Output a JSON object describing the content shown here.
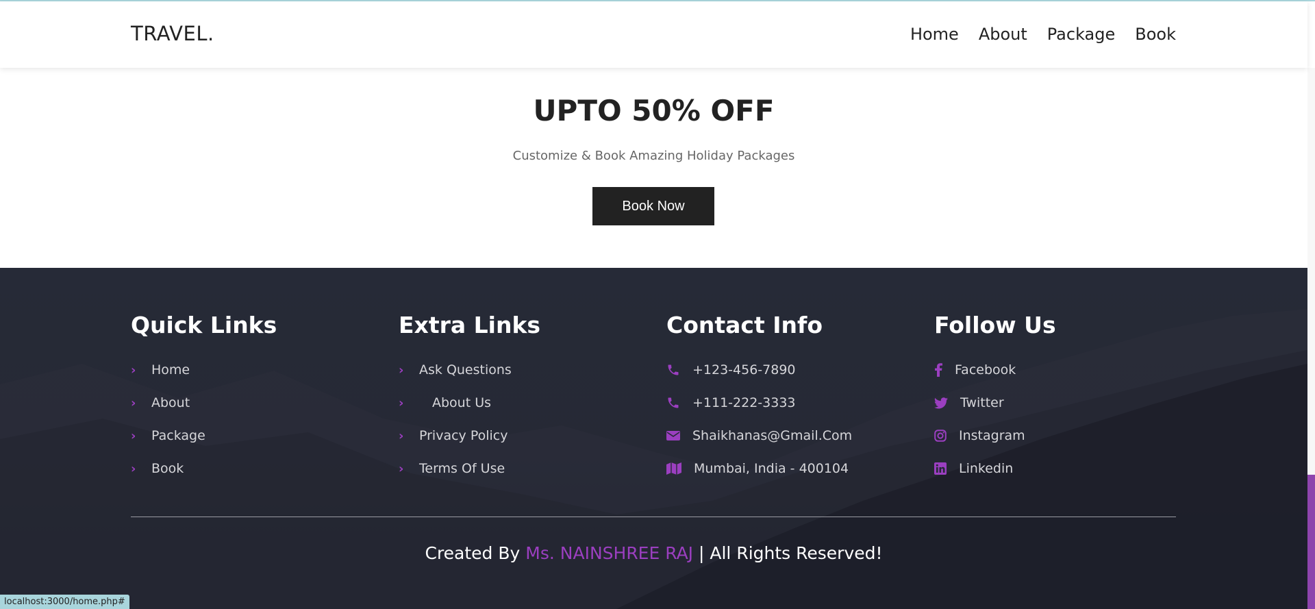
{
  "header": {
    "logo": "TRAVEL.",
    "nav": [
      "Home",
      "About",
      "Package",
      "Book"
    ]
  },
  "hero": {
    "title": "UPTO 50% OFF",
    "subtitle": "Customize & Book Amazing Holiday Packages",
    "button": "Book Now"
  },
  "footer": {
    "quick_links": {
      "title": "Quick Links",
      "items": [
        "Home",
        "About",
        "Package",
        "Book"
      ]
    },
    "extra_links": {
      "title": "Extra Links",
      "items": [
        "Ask Questions",
        "About Us",
        "Privacy Policy",
        "Terms Of Use"
      ]
    },
    "contact": {
      "title": "Contact Info",
      "items": [
        {
          "icon": "phone-icon",
          "text": "+123-456-7890"
        },
        {
          "icon": "phone-icon",
          "text": "+111-222-3333"
        },
        {
          "icon": "envelope-icon",
          "text": "Shaikhanas@Gmail.Com"
        },
        {
          "icon": "map-icon",
          "text": "Mumbai, India - 400104"
        }
      ]
    },
    "follow": {
      "title": "Follow Us",
      "items": [
        {
          "icon": "facebook-icon",
          "text": "Facebook"
        },
        {
          "icon": "twitter-icon",
          "text": "Twitter"
        },
        {
          "icon": "instagram-icon",
          "text": "Instagram"
        },
        {
          "icon": "linkedin-icon",
          "text": "Linkedin"
        }
      ]
    },
    "credit": {
      "prefix": "Created By",
      "author": "Ms. NAINSHREE RAJ",
      "suffix": "| All Rights Reserved!"
    }
  },
  "status_bar": {
    "url": "localhost:3000/home.php#"
  },
  "colors": {
    "accent": "#9b3fc0",
    "footer_bg": "#262a37",
    "button_bg": "#222222"
  }
}
